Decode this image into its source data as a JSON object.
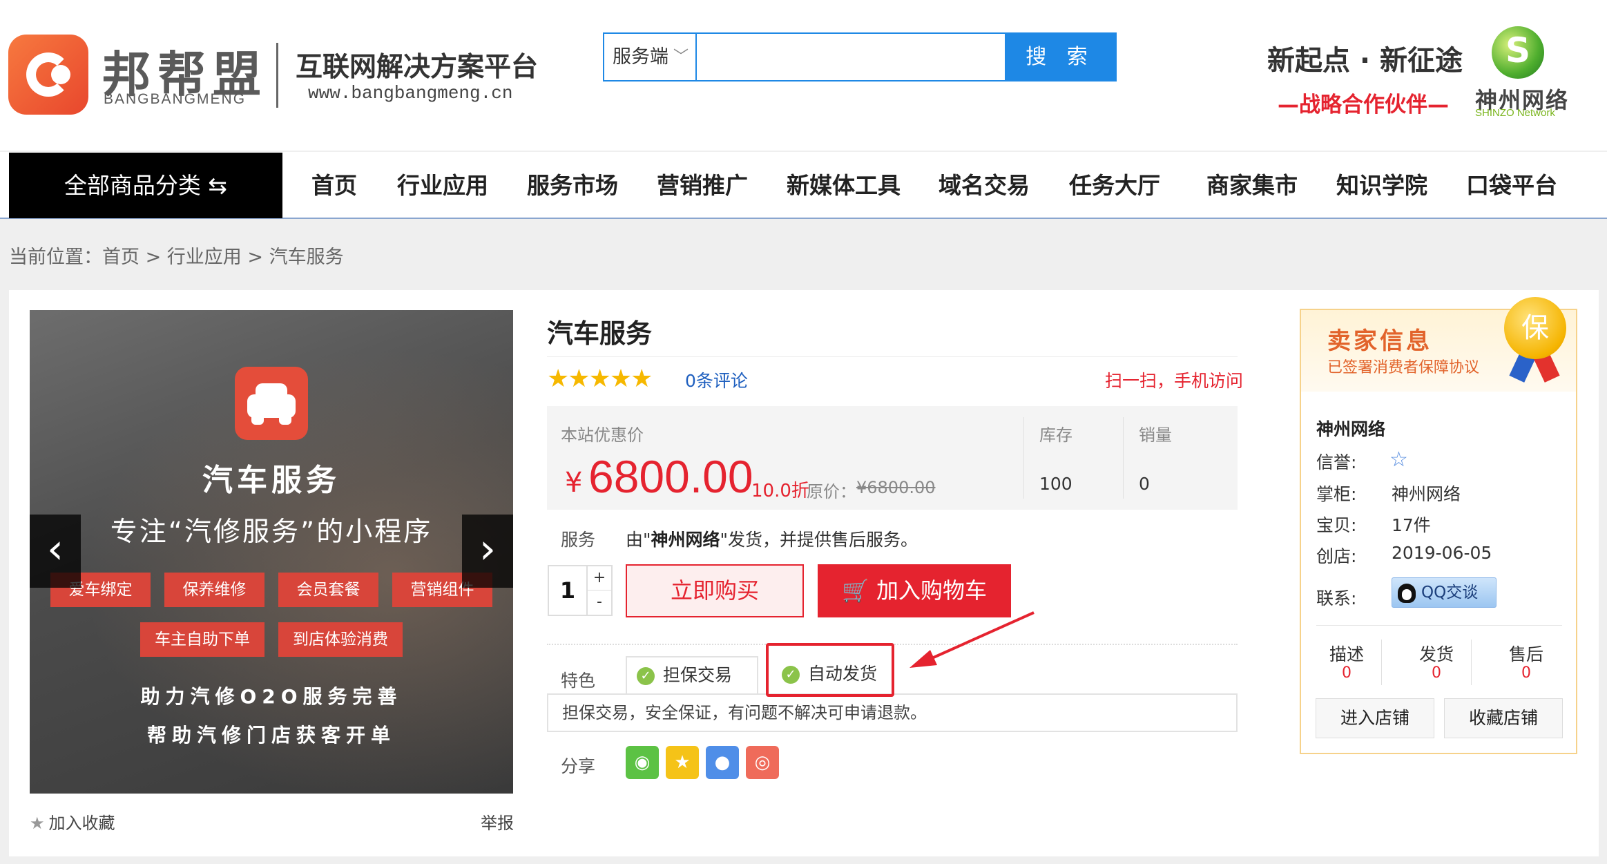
{
  "header": {
    "logo_cn": "邦帮盟",
    "logo_en": "BANGBANGMENG",
    "slogan": "互联网解决方案平台",
    "url": "www.bangbangmeng.cn",
    "search": {
      "scope": "服务端",
      "placeholder": "",
      "button": "搜 索"
    },
    "promo_line1": "新起点 · 新征途",
    "promo_line2": "—战略合作伙伴—",
    "partner": {
      "name": "神州网络",
      "en": "SHINZO Network"
    }
  },
  "nav": {
    "all_categories": "全部商品分类 ⇆",
    "items": [
      "首页",
      "行业应用",
      "服务市场",
      "营销推广",
      "新媒体工具",
      "域名交易",
      "任务大厅",
      "商家集市",
      "知识学院",
      "口袋平台"
    ]
  },
  "breadcrumb": "当前位置：首页 > 行业应用 > 汽车服务",
  "gallery": {
    "title": "汽车服务",
    "subtitle": "专注“汽修服务”的小程序",
    "tags_row1": [
      "爱车绑定",
      "保养维修",
      "会员套餐",
      "营销组件"
    ],
    "tags_row2": [
      "车主自助下单",
      "到店体验消费"
    ],
    "line1": "助力汽修O2O服务完善",
    "line2": "帮助汽修门店获客开单",
    "prev": "‹",
    "next": "›",
    "favorite": "加入收藏",
    "report": "举报"
  },
  "product": {
    "title": "汽车服务",
    "rating_stars": "★★★★★",
    "reviews": "0条评论",
    "mobile": "扫一扫，手机访问",
    "price_label": "本站优惠价",
    "currency": "¥",
    "price": "6800.00",
    "discount": "10.0折",
    "orig_label": "原价：",
    "orig_price": "¥6800.00",
    "stock_label": "库存",
    "stock": "100",
    "sales_label": "销量",
    "sales": "0",
    "service_label": "服务",
    "service_prefix": "由\"",
    "service_seller": "神州网络",
    "service_suffix": "\"发货，并提供售后服务。",
    "quantity": "1",
    "buy_now": "立即购买",
    "add_cart": "加入购物车",
    "features_label": "特色",
    "features": [
      "担保交易",
      "自动发货"
    ],
    "feature_desc": "担保交易，安全保证，有问题不解决可申请退款。",
    "share_label": "分享"
  },
  "seller": {
    "title": "卖家信息",
    "subtitle": "已签署消费者保障协议",
    "badge": "保",
    "shop": "神州网络",
    "reputation_label": "信誉:",
    "owner_label": "掌柜:",
    "owner": "神州网络",
    "items_label": "宝贝:",
    "items": "17件",
    "opened_label": "创店:",
    "opened": "2019-06-05",
    "contact_label": "联系:",
    "qq": "QQ交谈",
    "ratings": [
      {
        "label": "描述",
        "value": "0"
      },
      {
        "label": "发货",
        "value": "0"
      },
      {
        "label": "售后",
        "value": "0"
      }
    ],
    "enter_shop": "进入店铺",
    "fav_shop": "收藏店铺"
  }
}
